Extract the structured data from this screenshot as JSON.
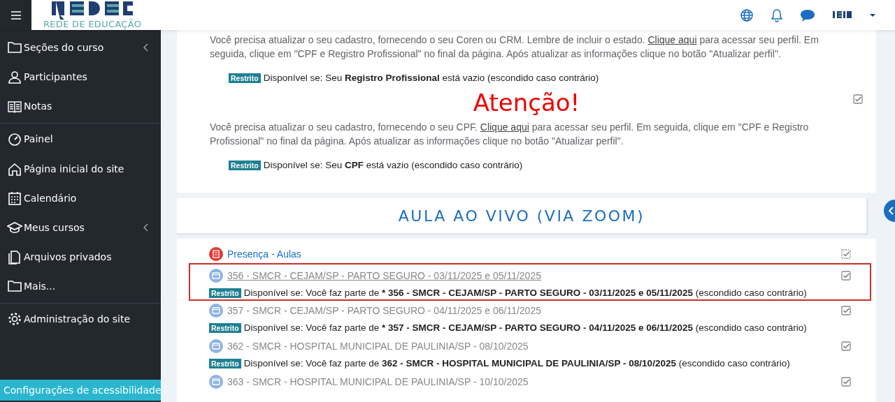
{
  "topbar": {
    "logo_caption": "REDE DE EDUCAÇÃO"
  },
  "sidebar": {
    "items": [
      {
        "label": "Seções do curso",
        "has_submenu": true,
        "divider_before": false
      },
      {
        "label": "Participantes",
        "has_submenu": false,
        "divider_before": false
      },
      {
        "label": "Notas",
        "has_submenu": false,
        "divider_before": false
      },
      {
        "label": "Painel",
        "has_submenu": false,
        "divider_before": true
      },
      {
        "label": "Página inicial do site",
        "has_submenu": false,
        "divider_before": false
      },
      {
        "label": "Calendário",
        "has_submenu": false,
        "divider_before": false
      },
      {
        "label": "Meus cursos",
        "has_submenu": true,
        "divider_before": false
      },
      {
        "label": "Arquivos privados",
        "has_submenu": false,
        "divider_before": false
      },
      {
        "label": "Mais...",
        "has_submenu": false,
        "divider_before": false
      },
      {
        "label": "Administração do site",
        "has_submenu": false,
        "divider_before": true
      }
    ],
    "accessibility_button": "Configurações de acessibilidade"
  },
  "notices": [
    {
      "kind": "text",
      "before": "Você precisa atualizar o seu cadastro, fornecendo o seu Coren ou CRM. Lembre de incluir o estado.  ",
      "link": "Clique aqui",
      "after": " para acessar seu perfil. Em seguida, clique em \"CPF e Registro Profissional\" no final da página. Após atualizar as informações clique no botão \"Atualizar perfil\".",
      "badge": "Restrito",
      "restriction": {
        "before": "Disponível se: Seu ",
        "bold": "Registro Profissional",
        "after": " está vazio (escondido caso contrário)"
      }
    },
    {
      "kind": "alert",
      "title": "Atenção!",
      "before": "Você precisa atualizar o seu cadastro, fornecendo o seu CPF.  ",
      "link": "Clique aqui",
      "after": " para acessar seu perfil. Em seguida, clique em \"CPF e Registro Profissional\" no final da página. Após atualizar as informações clique no botão \"Atualizar perfil\".",
      "badge": "Restrito",
      "restriction": {
        "before": "Disponível se: Seu ",
        "bold": "CPF",
        "after": " está vazio (escondido caso contrário)"
      },
      "checked": true
    }
  ],
  "section": {
    "title": "AULA AO VIVO (VIA ZOOM)"
  },
  "activities": [
    {
      "kind": "attendance",
      "name": "Presença - Aulas",
      "dimmed": false,
      "highlighted": false,
      "checked": true
    },
    {
      "kind": "page",
      "name": "356 - SMCR - CEJAM/SP - PARTO SEGURO - 03/11/2025 e 05/11/2025",
      "dimmed": true,
      "highlighted": true,
      "checked": true,
      "badge": "Restrito",
      "restriction": {
        "before": "Disponível se: Você faz parte de ",
        "bold": "* 356 - SMCR - CEJAM/SP - PARTO SEGURO - 03/11/2025 e 05/11/2025",
        "after": " (escondido caso contrário)"
      }
    },
    {
      "kind": "page",
      "name": "357 - SMCR - CEJAM/SP - PARTO SEGURO - 04/11/2025 e 06/11/2025",
      "dimmed": true,
      "highlighted": false,
      "checked": true,
      "badge": "Restrito",
      "restriction": {
        "before": "Disponível se: Você faz parte de ",
        "bold": "* 357 - SMCR - CEJAM/SP - PARTO SEGURO - 04/11/2025 e 06/11/2025",
        "after": " (escondido caso contrário)"
      }
    },
    {
      "kind": "page",
      "name": "362 - SMCR - HOSPITAL MUNICIPAL DE PAULINIA/SP - 08/10/2025",
      "dimmed": true,
      "highlighted": false,
      "checked": true,
      "badge": "Restrito",
      "restriction": {
        "before": "Disponível se: Você faz parte de ",
        "bold": "362 - SMCR - HOSPITAL MUNICIPAL DE PAULINIA/SP - 08/10/2025",
        "after": " (escondido caso contrário)"
      }
    },
    {
      "kind": "page",
      "name": "363 - SMCR - HOSPITAL MUNICIPAL DE PAULINIA/SP - 10/10/2025",
      "dimmed": true,
      "highlighted": false,
      "checked": true
    }
  ]
}
